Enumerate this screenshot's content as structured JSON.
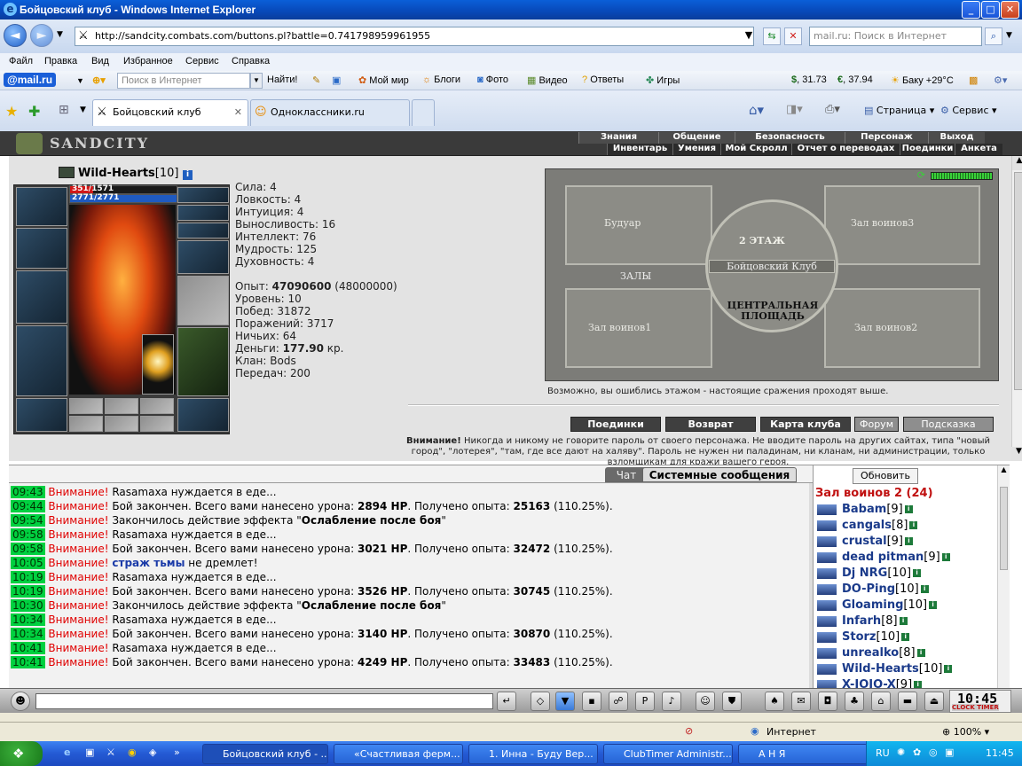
{
  "window": {
    "title": "Бойцовский клуб - Windows Internet Explorer"
  },
  "address_bar": {
    "url": "http://sandcity.combats.com/buttons.pl?battle=0.741798959961955",
    "search_placeholder": "mail.ru: Поиск в Интернет"
  },
  "menu": [
    "Файл",
    "Правка",
    "Вид",
    "Избранное",
    "Сервис",
    "Справка"
  ],
  "mailbar": {
    "brand": "@mail.ru",
    "search_placeholder": "Поиск в Интернет",
    "find": "Найти!",
    "links": [
      "Мой мир",
      "Блоги",
      "Фото",
      "Видео",
      "Ответы",
      "Игры"
    ],
    "usd": "31.73",
    "eur": "37.94",
    "weather": "Баку +29°C"
  },
  "tabs": [
    {
      "label": "Бойцовский клуб",
      "active": true
    },
    {
      "label": "Одноклассники.ru",
      "active": false
    }
  ],
  "ie_tools": {
    "page": "Страница",
    "service": "Сервис"
  },
  "game_menu": {
    "logo": "SANDCITY",
    "top": [
      "Знания",
      "Общение",
      "Безопасность",
      "Персонаж",
      "Выход"
    ],
    "sub": [
      "Инвентарь",
      "Умения",
      "Мой Скролл",
      "Отчет о переводах",
      "Поединки",
      "Анкета"
    ]
  },
  "character": {
    "name": "Wild-Hearts",
    "level": "[10]",
    "hp": "351/1571",
    "mana": "2771/2771",
    "hp_fraction": 0.22,
    "stats": [
      {
        "label": "Сила:",
        "value": "4"
      },
      {
        "label": "Ловкость:",
        "value": "4"
      },
      {
        "label": "Интуиция:",
        "value": "4"
      },
      {
        "label": "Выносливость:",
        "value": "16"
      },
      {
        "label": "Интеллект:",
        "value": "76"
      },
      {
        "label": "Мудрость:",
        "value": "125"
      },
      {
        "label": "Духовность:",
        "value": "4"
      }
    ],
    "exp_label": "Опыт:",
    "exp": "47090600",
    "exp_next": "(48000000)",
    "level_label": "Уровень:",
    "level_value": "10",
    "wins_label": "Побед:",
    "wins": "31872",
    "losses_label": "Поражений:",
    "losses": "3717",
    "draws_label": "Ничьих:",
    "draws": "64",
    "money_label": "Деньги:",
    "money": "177.90",
    "money_unit": "кр.",
    "clan_label": "Клан:",
    "clan": "Bods",
    "transfers_label": "Передач:",
    "transfers": "200"
  },
  "map": {
    "rooms": {
      "boudoir": "Будуар",
      "hall3": "Зал воинов3",
      "floor": "2 ЭТАЖ",
      "club": "Бойцовский Клуб",
      "halls": "ЗАЛЫ",
      "central": "ЦЕНТРАЛЬНАЯ ПЛОЩАДЬ",
      "hall1": "Зал воинов1",
      "hall2": "Зал воинов2"
    },
    "caption": "Возможно, вы ошиблись этажом - настоящие сражения проходят выше.",
    "buttons": [
      "Поединки",
      "Возврат",
      "Карта клуба",
      "Форум",
      "Подсказка"
    ],
    "warning_bold": "Внимание!",
    "warning": "Никогда и никому не говорите пароль от своего персонажа. Не вводите пароль на других сайтах, типа \"новый город\", \"лотерея\", \"там, где все дают на халяву\". Пароль не нужен ни паладинам, ни кланам, ни администрации, только взломщикам для кражи вашего героя."
  },
  "chat": {
    "tabs": [
      "Чат",
      "Системные сообщения"
    ],
    "messages": [
      {
        "time": "09:43",
        "att": "Внимание!",
        "text": " Rasamaxa нуждается в еде..."
      },
      {
        "time": "09:44",
        "att": "Внимание!",
        "text": " Бой закончен. Всего вами нанесено урона: ",
        "b1": "2894 HP",
        "t2": ". Получено опыта: ",
        "b2": "25163",
        "t3": " (110.25%)."
      },
      {
        "time": "09:54",
        "att": "Внимание!",
        "text": " Закончилось действие эффекта \"",
        "b1": "Ослабление после боя",
        "t2": "\""
      },
      {
        "time": "09:58",
        "att": "Внимание!",
        "text": " Rasamaxa нуждается в еде..."
      },
      {
        "time": "09:58",
        "att": "Внимание!",
        "text": " Бой закончен. Всего вами нанесено урона: ",
        "b1": "3021 HP",
        "t2": ". Получено опыта: ",
        "b2": "32472",
        "t3": " (110.25%)."
      },
      {
        "time": "10:05",
        "att": "Внимание!",
        "text": " ",
        "blue": "страж тьмы",
        "t2": " не дремлет!"
      },
      {
        "time": "10:19",
        "att": "Внимание!",
        "text": " Rasamaxa нуждается в еде..."
      },
      {
        "time": "10:19",
        "att": "Внимание!",
        "text": " Бой закончен. Всего вами нанесено урона: ",
        "b1": "3526 HP",
        "t2": ". Получено опыта: ",
        "b2": "30745",
        "t3": " (110.25%)."
      },
      {
        "time": "10:30",
        "att": "Внимание!",
        "text": " Закончилось действие эффекта \"",
        "b1": "Ослабление после боя",
        "t2": "\""
      },
      {
        "time": "10:34",
        "att": "Внимание!",
        "text": " Rasamaxa нуждается в еде..."
      },
      {
        "time": "10:34",
        "att": "Внимание!",
        "text": " Бой закончен. Всего вами нанесено урона: ",
        "b1": "3140 HP",
        "t2": ". Получено опыта: ",
        "b2": "30870",
        "t3": " (110.25%)."
      },
      {
        "time": "10:41",
        "att": "Внимание!",
        "text": " Rasamaxa нуждается в еде..."
      },
      {
        "time": "10:41",
        "att": "Внимание!",
        "text": " Бой закончен. Всего вами нанесено урона: ",
        "b1": "4249 HP",
        "t2": ". Получено опыта: ",
        "b2": "33483",
        "t3": " (110.25%)."
      }
    ]
  },
  "userlist": {
    "refresh": "Обновить",
    "room": "Зал воинов 2 (24)",
    "users": [
      {
        "name": "Babam",
        "lvl": "[9]"
      },
      {
        "name": "cangals",
        "lvl": "[8]"
      },
      {
        "name": "crustal",
        "lvl": "[9]"
      },
      {
        "name": "dead pitman",
        "lvl": "[9]"
      },
      {
        "name": "Dj NRG",
        "lvl": "[10]"
      },
      {
        "name": "DO-Ping",
        "lvl": "[10]"
      },
      {
        "name": "Gloaming",
        "lvl": "[10]"
      },
      {
        "name": "Infarh",
        "lvl": "[8]"
      },
      {
        "name": "Storz",
        "lvl": "[10]"
      },
      {
        "name": "unrealko",
        "lvl": "[8]"
      },
      {
        "name": "Wild-Hearts",
        "lvl": "[10]"
      },
      {
        "name": "X-JOJO-X",
        "lvl": "[9]"
      }
    ]
  },
  "clock": {
    "time": "10:45",
    "label": "CLOCK TIMER"
  },
  "statusbar": {
    "zone": "Интернет",
    "zoom": "100%"
  },
  "taskbar": {
    "tasks": [
      "Бойцовский клуб - ...",
      "«Счастливая ферм...",
      "1. Инна - Буду Вер...",
      "ClubTimer Administr...",
      "А Н Я"
    ],
    "lang": "RU",
    "time": "11:45"
  }
}
